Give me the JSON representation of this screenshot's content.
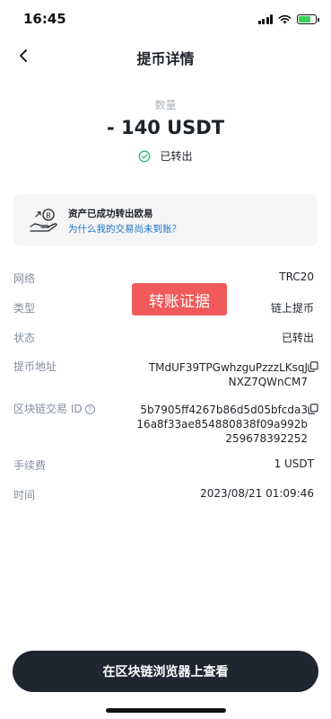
{
  "status_bar": {
    "time": "16:45"
  },
  "header": {
    "title": "提币详情"
  },
  "amount": {
    "label": "数量",
    "value": "- 140 USDT",
    "status": "已转出"
  },
  "notice": {
    "title": "资产已成功转出欧易",
    "link": "为什么我的交易尚未到账？"
  },
  "watermark": "转账证据",
  "details": {
    "network": {
      "label": "网络",
      "value": "TRC20"
    },
    "type": {
      "label": "类型",
      "value": "链上提币"
    },
    "state": {
      "label": "状态",
      "value": "已转出"
    },
    "address": {
      "label": "提币地址",
      "value": "TMdUF39TPGwhzguPzzzLKsqJ\nNXZ7QWnCM7"
    },
    "txid": {
      "label": "区块链交易 ID",
      "value": "5b7905ff4267b86d5d05bfcda3\n16a8f33ae854880838f09a992b\n259678392252"
    },
    "fee": {
      "label": "手续费",
      "value": "1 USDT"
    },
    "time": {
      "label": "时间",
      "value": "2023/08/21 01:09:46"
    }
  },
  "button": {
    "label": "在区块链浏览器上查看"
  },
  "colors": {
    "accent": "#1a73c9",
    "success": "#2bb673",
    "watermark": "#f05a5a",
    "button": "#202630"
  },
  "icons": [
    "back-arrow-icon",
    "check-circle-icon",
    "hand-coin-icon",
    "copy-icon",
    "help-icon",
    "signal-icon",
    "wifi-icon",
    "battery-icon"
  ]
}
